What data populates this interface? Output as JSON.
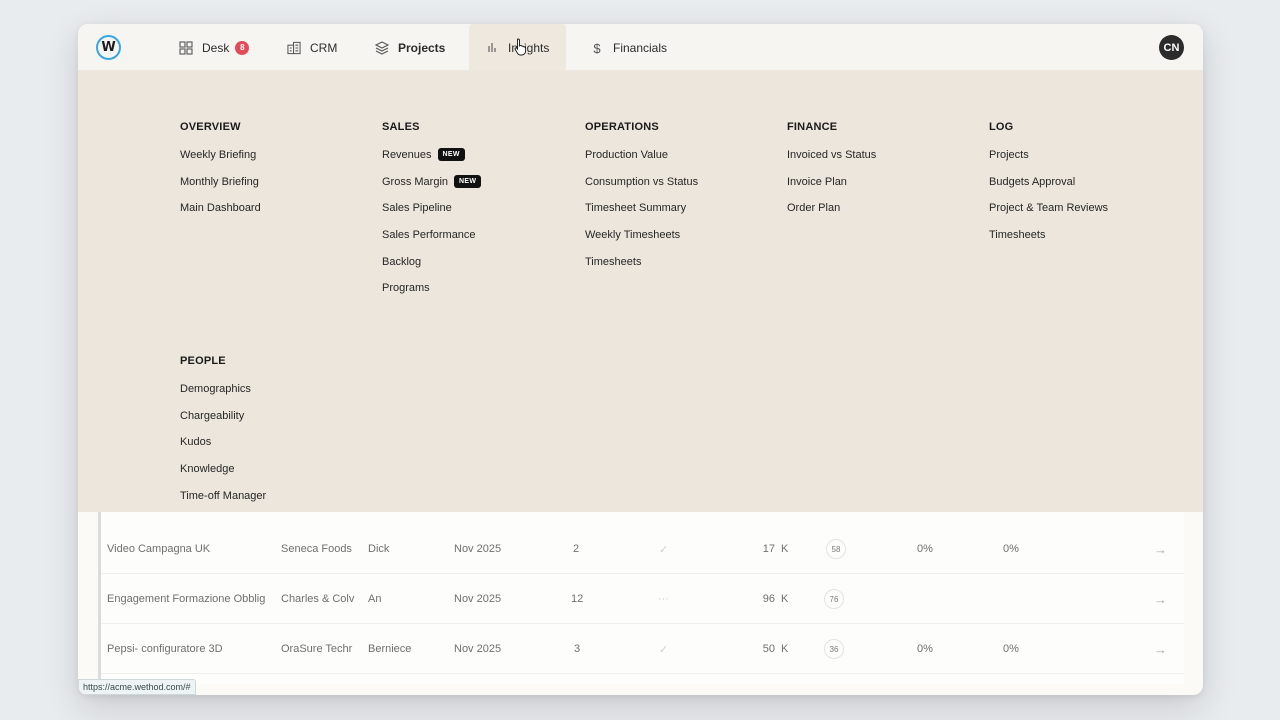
{
  "nav": {
    "logo": "W",
    "items": [
      {
        "label": "Desk",
        "badge": "8"
      },
      {
        "label": "CRM"
      },
      {
        "label": "Projects"
      },
      {
        "label": "Insights"
      },
      {
        "label": "Financials"
      }
    ],
    "avatar": "CN"
  },
  "menu": {
    "overview": {
      "title": "OVERVIEW",
      "links": [
        "Weekly Briefing",
        "Monthly Briefing",
        "Main Dashboard"
      ]
    },
    "sales": {
      "title": "SALES",
      "links": [
        "Revenues",
        "Gross Margin",
        "Sales Pipeline",
        "Sales Performance",
        "Backlog",
        "Programs"
      ],
      "new_tag": "NEW"
    },
    "operations": {
      "title": "OPERATIONS",
      "links": [
        "Production Value",
        "Consumption vs Status",
        "Timesheet Summary",
        "Weekly Timesheets",
        "Timesheets"
      ]
    },
    "finance": {
      "title": "FINANCE",
      "links": [
        "Invoiced vs Status",
        "Invoice Plan",
        "Order Plan"
      ]
    },
    "log": {
      "title": "LOG",
      "links": [
        "Projects",
        "Budgets Approval",
        "Project & Team Reviews",
        "Timesheets"
      ]
    },
    "people": {
      "title": "PEOPLE",
      "links": [
        "Demographics",
        "Chargeability",
        "Kudos",
        "Knowledge",
        "Time-off Manager"
      ]
    }
  },
  "rows": [
    {
      "project": "Video Campagna UK",
      "client": "Seneca Foods",
      "pm": "Dick",
      "date": "Nov 2025",
      "count": "2",
      "status": "✓",
      "value": "17",
      "unit": "K",
      "score": "58",
      "p1": "0%",
      "p2": "0%"
    },
    {
      "project": "Engagement Formazione Obblig",
      "client": "Charles & Colv",
      "pm": "An",
      "date": "Nov 2025",
      "count": "12",
      "status": "···",
      "value": "96",
      "unit": "K",
      "score": "76",
      "p1": "",
      "p2": ""
    },
    {
      "project": "Pepsi- configuratore 3D",
      "client": "OraSure Techr",
      "pm": "Berniece",
      "date": "Nov 2025",
      "count": "3",
      "status": "✓",
      "value": "50",
      "unit": "K",
      "score": "36",
      "p1": "0%",
      "p2": "0%"
    }
  ],
  "arrow": "→",
  "status_url": "https://acme.wethod.com/#"
}
